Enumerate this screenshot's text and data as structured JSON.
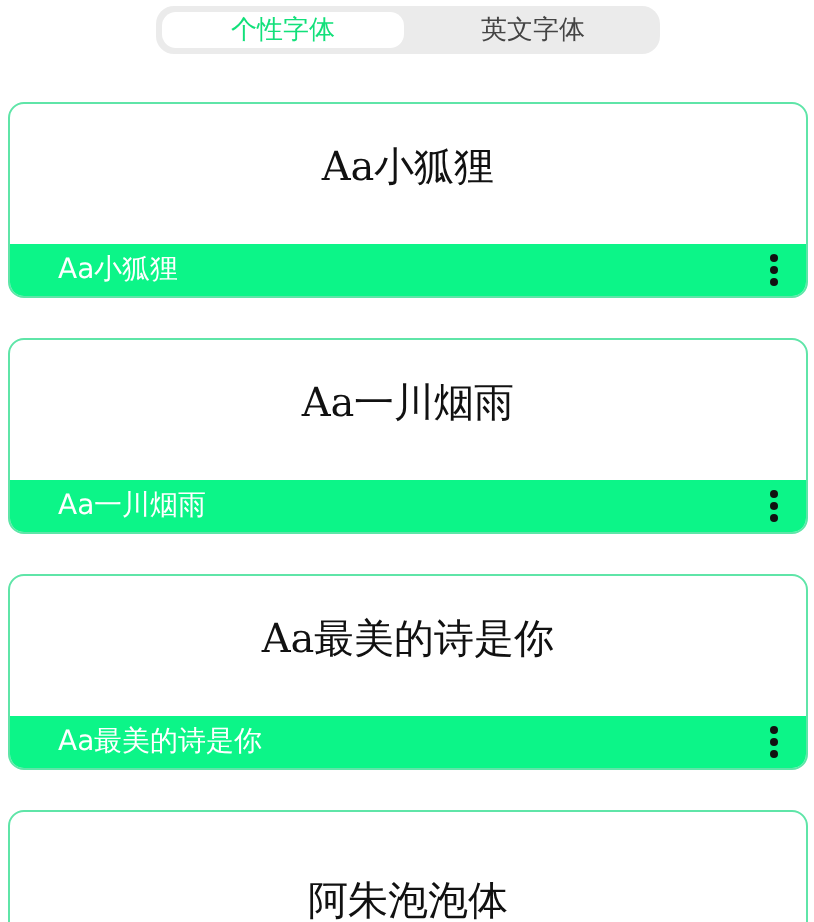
{
  "tabs": [
    {
      "label": "个性字体",
      "selected": true
    },
    {
      "label": "英文字体",
      "selected": false
    }
  ],
  "fonts": [
    {
      "preview": "Aa小狐狸",
      "label": "Aa小狐狸"
    },
    {
      "preview": "Aa一川烟雨",
      "label": "Aa一川烟雨"
    },
    {
      "preview": "Aa最美的诗是你",
      "label": "Aa最美的诗是你"
    },
    {
      "preview": "阿朱泡泡体"
    }
  ]
}
